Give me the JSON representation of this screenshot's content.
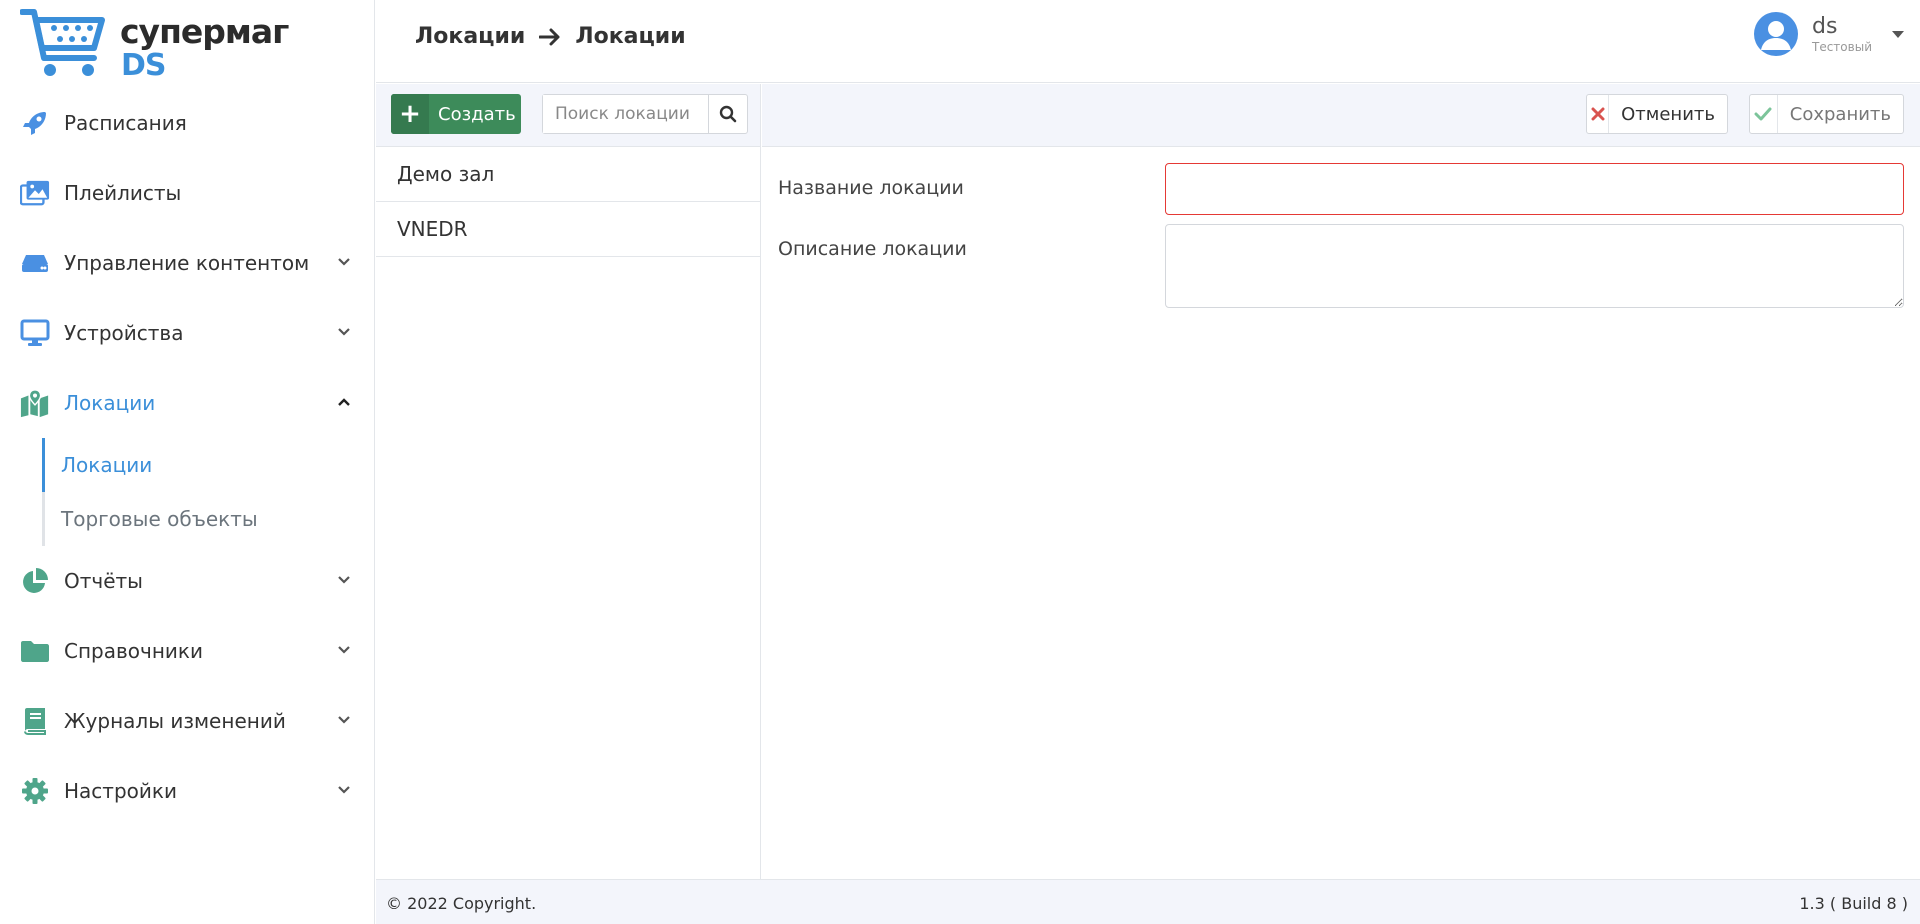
{
  "logo": {
    "line1": "супермаг",
    "line2": "DS"
  },
  "sidebar": {
    "items": [
      {
        "label": "Расписания",
        "icon": "rocket-icon",
        "expandable": false
      },
      {
        "label": "Плейлисты",
        "icon": "images-icon",
        "expandable": false
      },
      {
        "label": "Управление контентом",
        "icon": "server-icon",
        "expandable": true
      },
      {
        "label": "Устройства",
        "icon": "monitor-icon",
        "expandable": true
      },
      {
        "label": "Локации",
        "icon": "map-icon",
        "expandable": true,
        "expanded": true,
        "active": true
      },
      {
        "label": "Отчёты",
        "icon": "pie-chart-icon",
        "expandable": true
      },
      {
        "label": "Справочники",
        "icon": "folder-icon",
        "expandable": true
      },
      {
        "label": "Журналы изменений",
        "icon": "book-icon",
        "expandable": true
      },
      {
        "label": "Настройки",
        "icon": "gear-icon",
        "expandable": true
      }
    ],
    "sub_items": [
      {
        "label": "Локации",
        "active": true
      },
      {
        "label": "Торговые объекты",
        "active": false
      }
    ]
  },
  "header": {
    "breadcrumb": [
      "Локации",
      "Локации"
    ],
    "user": {
      "name": "ds",
      "role": "Тестовый"
    }
  },
  "list": {
    "create_label": "Создать",
    "search_placeholder": "Поиск локации",
    "rows": [
      "Демо зал",
      "VNEDR"
    ]
  },
  "form": {
    "cancel_label": "Отменить",
    "save_label": "Сохранить",
    "name_label": "Название локации",
    "name_value": "",
    "description_label": "Описание локации",
    "description_value": ""
  },
  "footer": {
    "copyright": "© 2022 Copyright.",
    "version": "1.3 ( Build 8 )"
  },
  "colors": {
    "accent": "#3b8fd9",
    "icon_green": "#4fa58a",
    "create_button": "#3d8b5a",
    "error_border": "#e53935",
    "toolbar_bg": "#f3f5fb"
  }
}
